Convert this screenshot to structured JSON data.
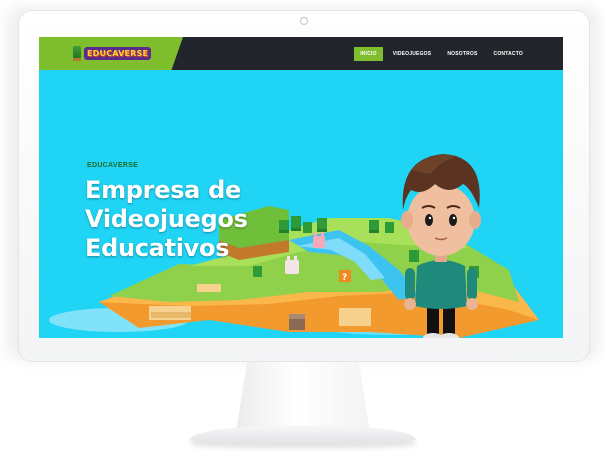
{
  "brand": {
    "logo_text": "EDUCAVERSE"
  },
  "nav": {
    "items": [
      {
        "label": "INICIO",
        "active": true
      },
      {
        "label": "VIDEOJUEGOS",
        "active": false
      },
      {
        "label": "NOSOTROS",
        "active": false
      },
      {
        "label": "CONTACTO",
        "active": false
      }
    ]
  },
  "hero": {
    "eyebrow": "EDUCAVERSE",
    "title": "Empresa de Videojuegos Educativos"
  },
  "colors": {
    "accent_green": "#7fbe2d",
    "header_dark": "#22252b",
    "sky": "#1fd4f5"
  }
}
